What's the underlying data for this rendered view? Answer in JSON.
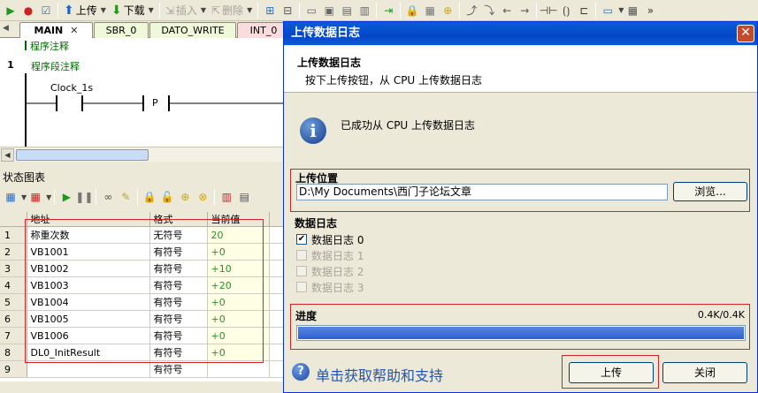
{
  "toolbar": {
    "upload_label": "上传",
    "download_label": "下载",
    "insert_label": "插入",
    "delete_label": "删除"
  },
  "tabs": [
    {
      "label": "MAIN"
    },
    {
      "label": "SBR_0"
    },
    {
      "label": "DATO_WRITE"
    },
    {
      "label": "INT_0"
    }
  ],
  "editor": {
    "program_comment": "程序注释",
    "network_number": "1",
    "network_comment": "程序段注释",
    "contact_label": "Clock_1s",
    "p_label": "P"
  },
  "status_chart": {
    "title": "状态图表",
    "columns": [
      "",
      "地址",
      "格式",
      "当前值"
    ],
    "rows": [
      {
        "idx": "1",
        "address": "称重次数",
        "format": "无符号",
        "value": "20"
      },
      {
        "idx": "2",
        "address": "VB1001",
        "format": "有符号",
        "value": "+0"
      },
      {
        "idx": "3",
        "address": "VB1002",
        "format": "有符号",
        "value": "+10"
      },
      {
        "idx": "4",
        "address": "VB1003",
        "format": "有符号",
        "value": "+20"
      },
      {
        "idx": "5",
        "address": "VB1004",
        "format": "有符号",
        "value": "+0"
      },
      {
        "idx": "6",
        "address": "VB1005",
        "format": "有符号",
        "value": "+0"
      },
      {
        "idx": "7",
        "address": "VB1006",
        "format": "有符号",
        "value": "+0"
      },
      {
        "idx": "8",
        "address": "DL0_InitResult",
        "format": "有符号",
        "value": "+0"
      },
      {
        "idx": "9",
        "address": "",
        "format": "有符号",
        "value": ""
      }
    ]
  },
  "dialog": {
    "title": "上传数据日志",
    "header_title": "上传数据日志",
    "header_sub": "按下上传按钮，从 CPU 上传数据日志",
    "success_message": "已成功从 CPU 上传数据日志",
    "location_label": "上传位置",
    "location_path": "D:\\My Documents\\西门子论坛文章",
    "browse_label": "浏览...",
    "datalog_label": "数据日志",
    "datalogs": [
      {
        "label": "数据日志 0",
        "checked": true,
        "enabled": true
      },
      {
        "label": "数据日志 1",
        "checked": false,
        "enabled": false
      },
      {
        "label": "数据日志 2",
        "checked": false,
        "enabled": false
      },
      {
        "label": "数据日志 3",
        "checked": false,
        "enabled": false
      }
    ],
    "progress_label": "进度",
    "progress_text": "0.4K/0.4K",
    "progress_fraction": 1.0,
    "help_text": "单击获取帮助和支持",
    "upload_button": "上传",
    "close_button": "关闭"
  },
  "colors": {
    "dialog_title_bg": "#0546c7",
    "highlight": "#d12424",
    "value_green": "#2a8f2a",
    "progress_fill": "#2b60d1"
  }
}
